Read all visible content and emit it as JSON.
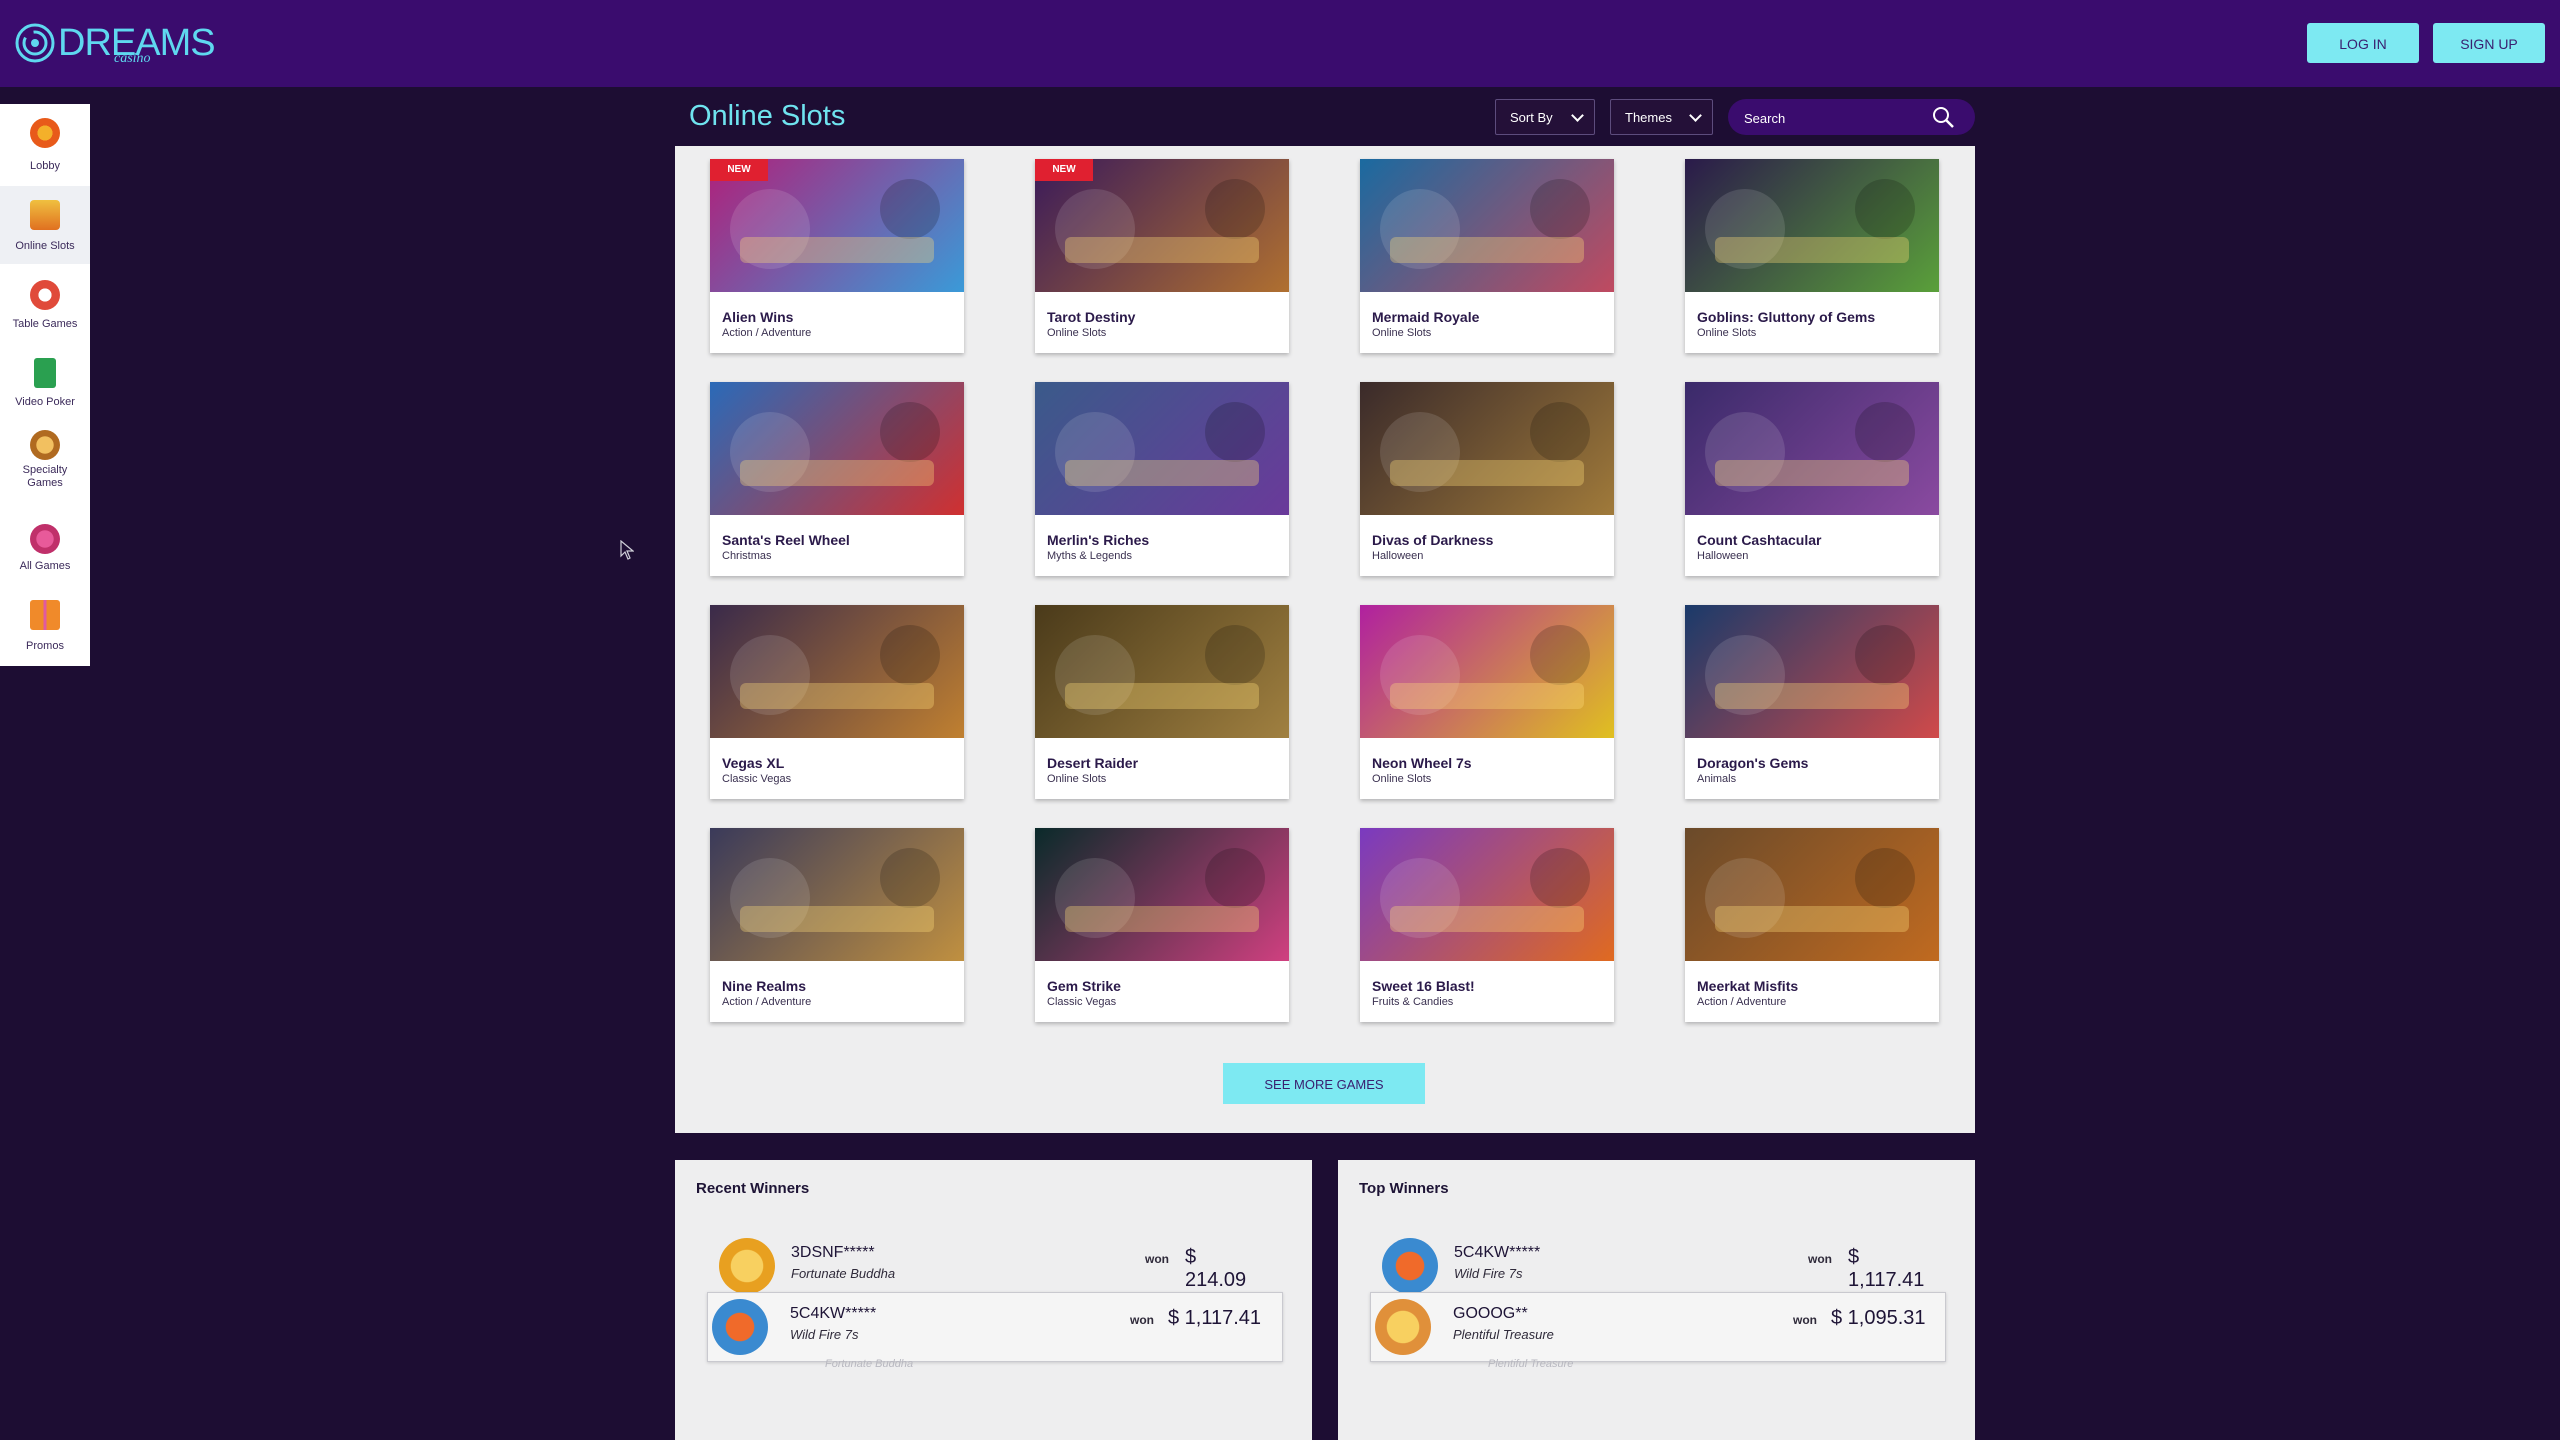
{
  "header": {
    "logo_word": "DREAMS",
    "logo_sub": "casino",
    "login_label": "LOG IN",
    "signup_label": "SIGN UP"
  },
  "sidenav": [
    {
      "label": "Lobby",
      "icon": "lobby-icon"
    },
    {
      "label": "Online Slots",
      "icon": "slot-machine-icon"
    },
    {
      "label": "Table Games",
      "icon": "poker-chip-icon"
    },
    {
      "label": "Video Poker",
      "icon": "playing-card-icon"
    },
    {
      "label": "Specialty Games",
      "icon": "specialty-icon"
    },
    {
      "label": "All Games",
      "icon": "all-games-icon"
    },
    {
      "label": "Promos",
      "icon": "gift-icon"
    }
  ],
  "main": {
    "title": "Online Slots",
    "sort_label": "Sort By",
    "themes_label": "Themes",
    "search_placeholder": "Search",
    "new_badge": "NEW",
    "see_more_label": "SEE MORE GAMES"
  },
  "games": [
    {
      "name": "Alien Wins",
      "category": "Action / Adventure",
      "badge": "NEW",
      "colors": [
        "#b0207a",
        "#3a9ad8"
      ]
    },
    {
      "name": "Tarot Destiny",
      "category": "Online Slots",
      "badge": "NEW",
      "colors": [
        "#3a1a5a",
        "#b07030"
      ]
    },
    {
      "name": "Mermaid Royale",
      "category": "Online Slots",
      "badge": "",
      "colors": [
        "#1a6aa0",
        "#c04a60"
      ]
    },
    {
      "name": "Goblins: Gluttony of Gems",
      "category": "Online Slots",
      "badge": "",
      "colors": [
        "#2a1a4a",
        "#5aa03a"
      ]
    },
    {
      "name": "Santa's Reel Wheel",
      "category": "Christmas",
      "badge": "",
      "colors": [
        "#2a6ab8",
        "#d03030"
      ]
    },
    {
      "name": "Merlin's Riches",
      "category": "Myths & Legends",
      "badge": "",
      "colors": [
        "#3a5a8a",
        "#6a3a9a"
      ]
    },
    {
      "name": "Divas of Darkness",
      "category": "Halloween",
      "badge": "",
      "colors": [
        "#3a2a2a",
        "#a07a3a"
      ]
    },
    {
      "name": "Count Cashtacular",
      "category": "Halloween",
      "badge": "",
      "colors": [
        "#3a2a6a",
        "#8a4aa0"
      ]
    },
    {
      "name": "Vegas XL",
      "category": "Classic Vegas",
      "badge": "",
      "colors": [
        "#3a2a4a",
        "#c08030"
      ]
    },
    {
      "name": "Desert Raider",
      "category": "Online Slots",
      "badge": "",
      "colors": [
        "#4a3a1a",
        "#a08040"
      ]
    },
    {
      "name": "Neon Wheel 7s",
      "category": "Online Slots",
      "badge": "",
      "colors": [
        "#b020a0",
        "#e0c020"
      ]
    },
    {
      "name": "Doragon's Gems",
      "category": "Animals",
      "badge": "",
      "colors": [
        "#1a3a6a",
        "#d04a4a"
      ]
    },
    {
      "name": "Nine Realms",
      "category": "Action / Adventure",
      "badge": "",
      "colors": [
        "#3a3a5a",
        "#c09040"
      ]
    },
    {
      "name": "Gem Strike",
      "category": "Classic Vegas",
      "badge": "",
      "colors": [
        "#0a2a2a",
        "#d04080"
      ]
    },
    {
      "name": "Sweet 16 Blast!",
      "category": "Fruits & Candies",
      "badge": "",
      "colors": [
        "#7a3ac0",
        "#e06a20"
      ]
    },
    {
      "name": "Meerkat Misfits",
      "category": "Action / Adventure",
      "badge": "",
      "colors": [
        "#6a4a2a",
        "#c06a20"
      ]
    }
  ],
  "winners": {
    "recent_title": "Recent Winners",
    "top_title": "Top Winners",
    "won_label": "won",
    "recent": [
      {
        "user": "3DSNF*****",
        "game": "Fortunate Buddha",
        "amount": "$ 214.09",
        "avatar": "#e8a020"
      },
      {
        "user": "5C4KW*****",
        "game": "Wild Fire 7s",
        "amount": "$ 1,117.41",
        "avatar": "#3a8ad0"
      }
    ],
    "recent_ghost": "Fortunate Buddha",
    "top": [
      {
        "user": "5C4KW*****",
        "game": "Wild Fire 7s",
        "amount": "$ 1,117.41",
        "avatar": "#3a8ad0"
      },
      {
        "user": "GOOOG**",
        "game": "Plentiful Treasure",
        "amount": "$ 1,095.31",
        "avatar": "#e0903a"
      }
    ],
    "top_ghost": "Plentiful Treasure"
  }
}
